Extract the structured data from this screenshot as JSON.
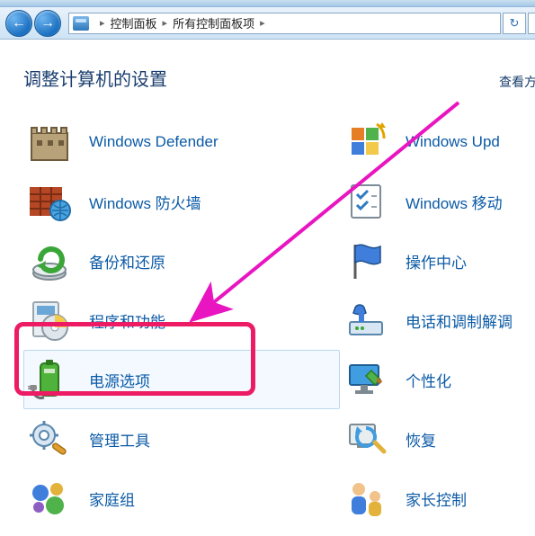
{
  "nav": {
    "back_glyph": "←",
    "fwd_glyph": "→",
    "refresh_glyph": "↻"
  },
  "breadcrumb": {
    "root": "控制面板",
    "current": "所有控制面板项",
    "sep": "▸"
  },
  "header": {
    "title": "调整计算机的设置",
    "view_hint": "查看方"
  },
  "items_left": [
    {
      "key": "windows-defender",
      "label": "Windows Defender"
    },
    {
      "key": "windows-firewall",
      "label": "Windows 防火墙"
    },
    {
      "key": "backup-restore",
      "label": "备份和还原"
    },
    {
      "key": "programs-features",
      "label": "程序和功能"
    },
    {
      "key": "power-options",
      "label": "电源选项"
    },
    {
      "key": "admin-tools",
      "label": "管理工具"
    },
    {
      "key": "homegroup",
      "label": "家庭组"
    }
  ],
  "items_right": [
    {
      "key": "windows-update",
      "label": "Windows Upd"
    },
    {
      "key": "windows-mobility",
      "label": "Windows 移动"
    },
    {
      "key": "action-center",
      "label": "操作中心"
    },
    {
      "key": "phone-modem",
      "label": "电话和调制解调"
    },
    {
      "key": "personalization",
      "label": "个性化"
    },
    {
      "key": "recovery",
      "label": "恢复"
    },
    {
      "key": "parental-controls",
      "label": "家长控制"
    }
  ],
  "annotation": {
    "highlighted_item_key": "power-options",
    "arrow_color": "#e815c0",
    "box_color": "#ec1b63"
  }
}
